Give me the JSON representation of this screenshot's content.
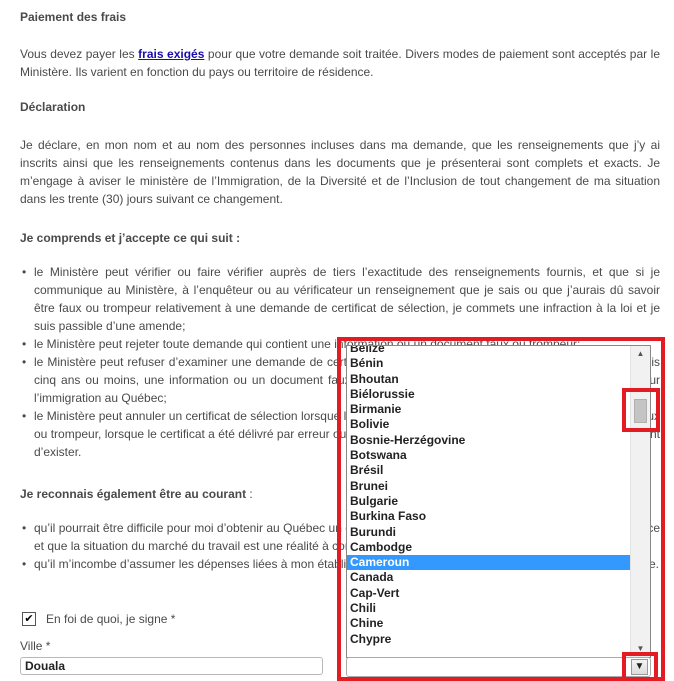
{
  "payment": {
    "heading": "Paiement des frais",
    "text_before": "Vous devez payer les ",
    "link": "frais exigés",
    "text_after": " pour que votre demande soit traitée. Divers modes de paiement sont acceptés par le Ministère. Ils varient en fonction du pays ou territoire de résidence."
  },
  "declaration": {
    "heading": "Déclaration",
    "text": "Je déclare, en mon nom et au nom des personnes incluses dans ma demande, que les renseignements que j’y ai inscrits ainsi que les renseignements contenus dans les documents que je présenterai sont complets et exacts. Je m’engage à aviser le ministère de l’Immigration, de la Diversité et de l’Inclusion de tout changement de ma situation dans les trente (30) jours suivant ce changement."
  },
  "accept": {
    "heading": "Je comprends et j’accepte ce qui suit :",
    "items": [
      "le Ministère peut vérifier ou faire vérifier auprès de tiers l’exactitude des renseignements fournis, et que si je communique au Ministère, à l’enquêteur ou au vérificateur un renseignement que je sais ou que j’aurais dû savoir être faux ou trompeur relativement à une demande de certificat de sélection, je commets une infraction à la loi et je suis passible d’une amende;",
      "le Ministère peut rejeter toute demande qui contient une information ou un document faux ou trompeur;",
      "le Ministère peut refuser d’examiner une demande de certificat de sélection si j’ai, dans ma demande, fourni, depuis cinq ans ou moins, une information ou un document faux ou trompeur, selon ce que prévoit l’article de la Loi sur l’immigration au Québec;",
      "le Ministère peut annuler un certificat de sélection lorsque la demande contenait une information ou un document faux ou trompeur, lorsque le certificat a été délivré par erreur ou lorsque les conditions requises pour sa délivrance cessent d’exister."
    ]
  },
  "aware": {
    "heading_bold": "Je reconnais également être au courant",
    "heading_rest": " :",
    "items": [
      "qu’il pourrait être difficile pour moi d’obtenir au Québec un emploi correspondant à ma formation ou à mon expérience et que la situation du marché du travail est une réalité à considérer;",
      "qu’il m’incombe d’assumer les dépenses liées à mon établissement et à mon intégration ainsi que ceux de ma famille."
    ]
  },
  "signature": {
    "checked": "✔",
    "label": "En foi de quoi, je signe",
    "required": " *"
  },
  "city": {
    "label": "Ville",
    "required": " *",
    "value": "Douala"
  },
  "country_dropdown": {
    "options": [
      "Belize",
      "Bénin",
      "Bhoutan",
      "Biélorussie",
      "Birmanie",
      "Bolivie",
      "Bosnie-Herzégovine",
      "Botswana",
      "Brésil",
      "Brunei",
      "Bulgarie",
      "Burkina Faso",
      "Burundi",
      "Cambodge",
      "Cameroun",
      "Canada",
      "Cap-Vert",
      "Chili",
      "Chine",
      "Chypre"
    ],
    "selected_index": 14,
    "scroll_up": "▲",
    "scroll_down": "▼",
    "select_button": "▼",
    "highlight_color": "#e31b23"
  }
}
